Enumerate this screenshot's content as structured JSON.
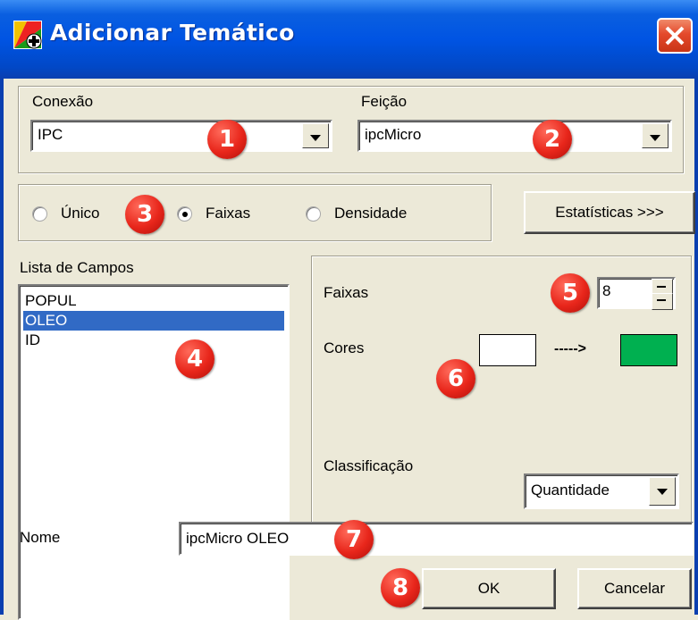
{
  "window": {
    "title": "Adicionar Temático"
  },
  "conexao": {
    "label": "Conexão",
    "value": "IPC"
  },
  "feicao": {
    "label": "Feição",
    "value": "ipcMicro"
  },
  "mode": {
    "options": [
      "Único",
      "Faixas",
      "Densidade"
    ],
    "selected": "Faixas"
  },
  "stats_button": "Estatísticas >>>",
  "fields": {
    "label": "Lista de Campos",
    "items": [
      "POPUL",
      "OLEO",
      "ID"
    ],
    "selected": "OLEO"
  },
  "faixas": {
    "label": "Faixas",
    "value": "8"
  },
  "cores": {
    "label": "Cores",
    "arrow": "----->",
    "from_color": "#ffffff",
    "to_color": "#00b050"
  },
  "classificacao": {
    "label": "Classificação",
    "value": "Quantidade"
  },
  "nome": {
    "label": "Nome",
    "value": "ipcMicro OLEO"
  },
  "buttons": {
    "ok": "OK",
    "cancel": "Cancelar"
  },
  "badges": [
    "1",
    "2",
    "3",
    "4",
    "5",
    "6",
    "7",
    "8"
  ]
}
